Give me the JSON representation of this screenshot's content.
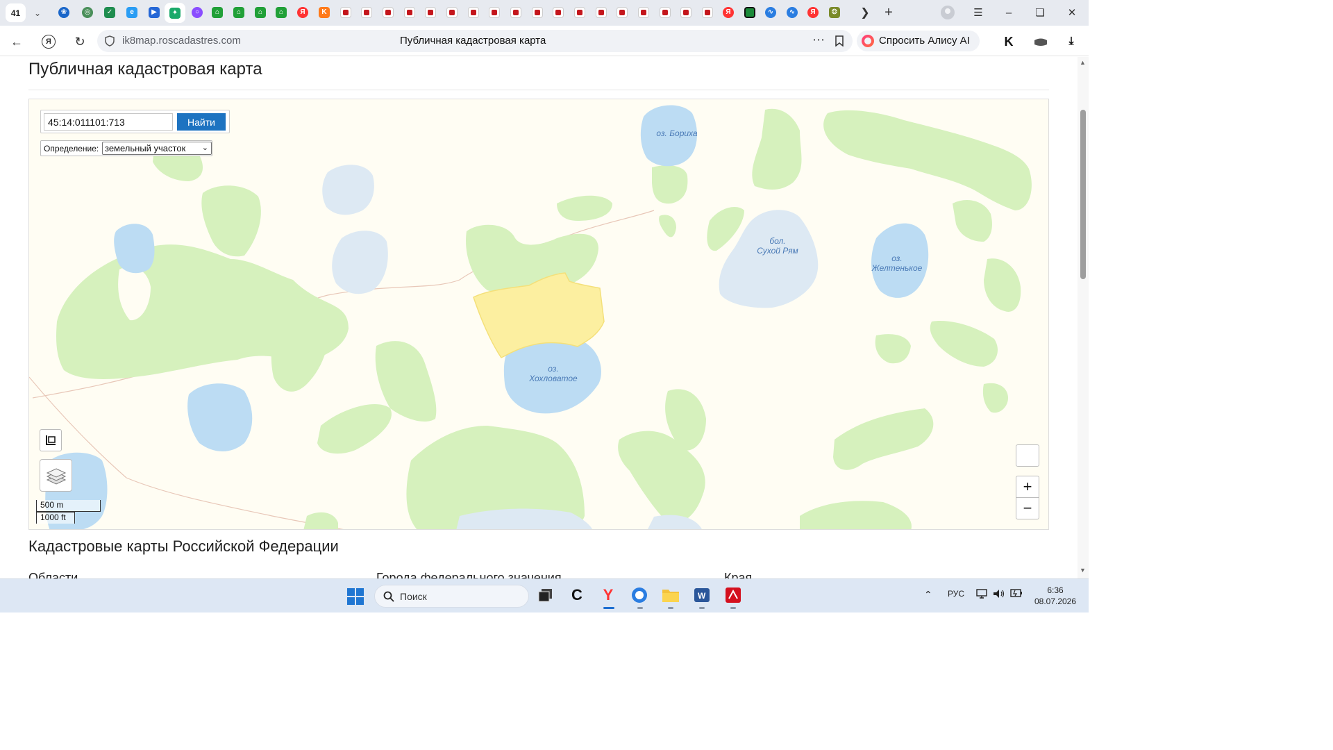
{
  "browser": {
    "tab_count": "41",
    "address": {
      "url": "ik8map.roscadastres.com",
      "page_title": "Публичная кадастровая карта"
    },
    "alice_label": "Спросить Алису AI"
  },
  "page": {
    "heading": "Публичная кадастровая карта",
    "map": {
      "search": {
        "value": "45:14:011101:713",
        "button_label": "Найти"
      },
      "definition": {
        "label": "Определение:",
        "selected": "земельный участок"
      },
      "lakes": [
        {
          "label_1": "оз. Бориха",
          "label_2": ""
        },
        {
          "label_1": "бол.",
          "label_2": "Сухой Рям"
        },
        {
          "label_1": "оз.",
          "label_2": "Желтенькое"
        },
        {
          "label_1": "оз.",
          "label_2": "Хохловатое"
        }
      ],
      "scale": {
        "metric": "500 m",
        "imperial": "1000 ft"
      },
      "zoom": {
        "in": "+",
        "out": "−"
      }
    },
    "section_heading": "Кадастровые карты Российской Федерации",
    "columns": [
      "Области",
      "Города федерального значения",
      "Края"
    ]
  },
  "taskbar": {
    "search_placeholder": "Поиск",
    "language": "РУС",
    "time": "6:36",
    "date": "08.07.2026"
  },
  "colors": {
    "tab_strip": "#e7eaf0",
    "search_button": "#1d73c1",
    "map_background": "#fffdf3",
    "vegetation": "#d6f1bd",
    "water": "#bcdcf3",
    "parcel_fill": "#fcefa0",
    "taskbar": "#dde7f4"
  }
}
